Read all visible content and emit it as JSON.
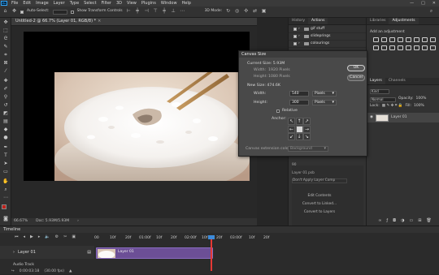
{
  "menu": [
    "File",
    "Edit",
    "Image",
    "Layer",
    "Type",
    "Select",
    "Filter",
    "3D",
    "View",
    "Plugins",
    "Window",
    "Help"
  ],
  "window_controls": [
    "—",
    "□",
    "✕"
  ],
  "options": {
    "auto_select": "Auto-Select:",
    "show_transform": "Show Transform Controls",
    "mode_3d": "3D Mode:"
  },
  "document": {
    "tab_title": "Untitled-2 @ 66.7% (Layer 01, RGB/8) *",
    "zoom": "66.67%",
    "status": "Doc: 5.93M/5.93M"
  },
  "panels_mid": {
    "tabs": [
      "History",
      "Actions"
    ],
    "actions": [
      "gif stuff",
      "slideprings",
      "colourings"
    ]
  },
  "panels_right": {
    "tabs": [
      "Libraries",
      "Adjustments"
    ],
    "add_adjustment": "Add an adjustment",
    "layer_tabs": [
      "Layers",
      "Channels"
    ],
    "kind": "Kind",
    "normal": "Normal",
    "opacity_label": "Opacity:",
    "opacity": "100%",
    "lock_label": "Lock:",
    "fill_label": "Fill:",
    "fill": "100%",
    "layer_name": "Layer 01"
  },
  "ext_panel": {
    "rows": [
      "90",
      "Layer 01 psb",
      "Don't Apply Layer Comp"
    ],
    "buttons": [
      "Edit Contents",
      "Convert to Linked...",
      "Convert to Layers"
    ]
  },
  "dialog": {
    "title": "Canvas Size",
    "current_size_label": "Current Size: 5.93M",
    "width_label": "Width:",
    "current_width": "1920 Pixels",
    "height_label": "Height:",
    "current_height": "1080 Pixels",
    "new_size_label": "New Size: 474.6K",
    "new_width": "540",
    "new_height": "300",
    "unit": "Pixels",
    "relative_label": "Relative",
    "anchor_label": "Anchor:",
    "ext_color_label": "Canvas extension color:",
    "ext_color": "Background",
    "ok": "OK",
    "cancel": "Cancel"
  },
  "timeline": {
    "title": "Timeline",
    "ruler": [
      "00",
      "10f",
      "20f",
      "01:00f",
      "10f",
      "20f",
      "02:00f",
      "10f",
      "20f",
      "03:00f",
      "10f",
      "20f"
    ],
    "layer_track": "Layer 01",
    "clip_label": "Layer 01",
    "audio_track": "Audio Track",
    "timecode": "0:00:03:18",
    "fps": "(30.00 fps)"
  },
  "colors": {
    "accent": "#31a8ff",
    "clip": "#6c4f96",
    "playhead": "#e53935",
    "fg_swatch": "#c0201a",
    "bg_swatch": "#ffffff"
  }
}
